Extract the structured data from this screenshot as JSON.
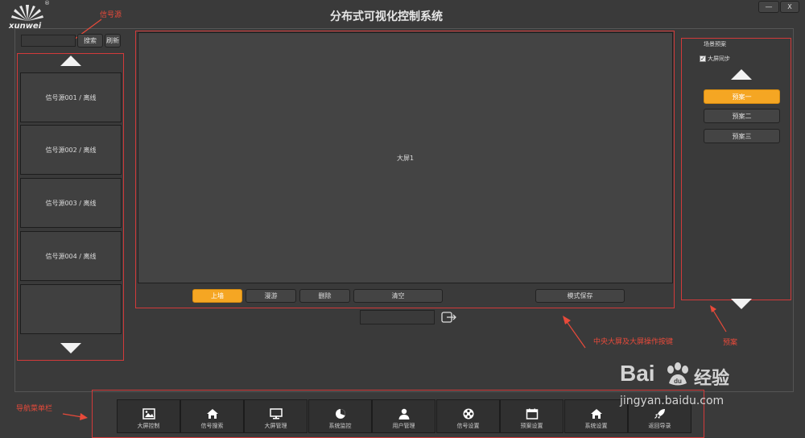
{
  "app": {
    "title": "分布式可视化控制系统",
    "logo_text": "xunwei",
    "logo_registered": "®",
    "window_controls": {
      "minimize": "—",
      "close": "X"
    }
  },
  "annotations": {
    "signal_source": "信号源",
    "center_screen": "中央大屏及大屏操作按键",
    "preset": "预案",
    "nav_menu": "导航菜单栏"
  },
  "left_panel": {
    "search_value": "",
    "search_label": "搜索",
    "refresh_label": "刷新",
    "sources": [
      {
        "label": "信号源001 / 离线"
      },
      {
        "label": "信号源002 / 离线"
      },
      {
        "label": "信号源003 / 离线"
      },
      {
        "label": "信号源004 / 离线"
      },
      {
        "label": ""
      }
    ]
  },
  "screen": {
    "label": "大屏1",
    "buttons": {
      "upload": "上墙",
      "roam": "漫游",
      "delete": "删除",
      "clear": "清空",
      "save_mode": "模式保存"
    },
    "mode_input_value": ""
  },
  "right_panel": {
    "title": "场景预案",
    "sync_label": "大屏同步",
    "sync_checked": true,
    "presets": [
      "预案一",
      "预案二",
      "预案三"
    ],
    "active_preset": 0
  },
  "nav": {
    "items": [
      {
        "label": "大屏控制",
        "icon": "image-icon"
      },
      {
        "label": "信号搜索",
        "icon": "home-icon"
      },
      {
        "label": "大屏管理",
        "icon": "monitor-icon"
      },
      {
        "label": "系统监控",
        "icon": "pie-chart-icon"
      },
      {
        "label": "用户管理",
        "icon": "user-icon"
      },
      {
        "label": "信号设置",
        "icon": "film-reel-icon"
      },
      {
        "label": "预案设置",
        "icon": "calendar-icon"
      },
      {
        "label": "系统设置",
        "icon": "home-icon"
      },
      {
        "label": "返回导录",
        "icon": "rocket-icon"
      }
    ]
  },
  "watermark": {
    "brand": "Bai",
    "brand_suffix": "经验",
    "url": "jingyan.baidu.com"
  },
  "colors": {
    "background": "#3a3a3a",
    "accent": "#f5a623",
    "annotation_red": "#e84a3a"
  }
}
